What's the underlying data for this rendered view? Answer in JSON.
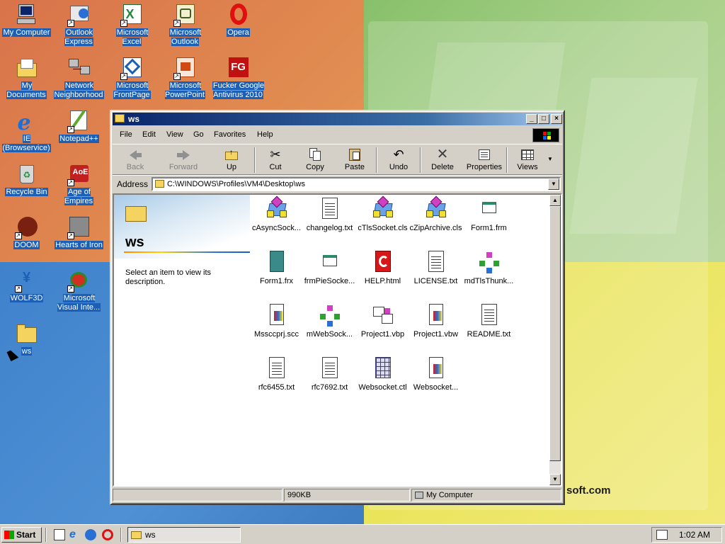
{
  "desktop": {
    "brand_text": "soft.com",
    "icons": [
      {
        "label": "My Computer",
        "icon": "my-computer-icon"
      },
      {
        "label": "Outlook Express",
        "icon": "outlook-express-icon"
      },
      {
        "label": "Microsoft Excel",
        "icon": "excel-icon"
      },
      {
        "label": "Microsoft Outlook",
        "icon": "outlook-icon"
      },
      {
        "label": "Opera",
        "icon": "opera-icon"
      },
      {
        "label": "My Documents",
        "icon": "my-documents-icon"
      },
      {
        "label": "Network Neighborhood",
        "icon": "network-icon"
      },
      {
        "label": "Microsoft FrontPage",
        "icon": "frontpage-icon"
      },
      {
        "label": "Microsoft PowerPoint",
        "icon": "powerpoint-icon"
      },
      {
        "label": "Fucker Google Antivirus 2010",
        "icon": "antivirus-icon"
      },
      {
        "label": "IE (Browservice)",
        "icon": "ie-icon"
      },
      {
        "label": "Notepad++",
        "icon": "notepad-icon"
      },
      {
        "label": "Recycle Bin",
        "icon": "recycle-bin-icon"
      },
      {
        "label": "Age of Empires",
        "icon": "age-of-empires-icon"
      },
      {
        "label": "DOOM",
        "icon": "doom-icon"
      },
      {
        "label": "Hearts of Iron",
        "icon": "hearts-of-iron-icon"
      },
      {
        "label": "WOLF3D",
        "icon": "wolf3d-icon"
      },
      {
        "label": "Microsoft Visual Inte...",
        "icon": "visual-interdev-icon"
      },
      {
        "label": "ws",
        "icon": "folder-icon"
      }
    ]
  },
  "window": {
    "title": "ws",
    "menu": [
      "File",
      "Edit",
      "View",
      "Go",
      "Favorites",
      "Help"
    ],
    "toolbar": [
      "Back",
      "Forward",
      "Up",
      "Cut",
      "Copy",
      "Paste",
      "Undo",
      "Delete",
      "Properties",
      "Views"
    ],
    "address_label": "Address",
    "address_value": "C:\\WINDOWS\\Profiles\\VM4\\Desktop\\ws",
    "webview": {
      "title": "ws",
      "description": "Select an item to view its description."
    },
    "files": [
      {
        "name": "cAsyncSock...",
        "icon": "class-file-icon"
      },
      {
        "name": "changelog.txt",
        "icon": "text-file-icon"
      },
      {
        "name": "cTlsSocket.cls",
        "icon": "class-file-icon"
      },
      {
        "name": "cZipArchive.cls",
        "icon": "class-file-icon"
      },
      {
        "name": "Form1.frm",
        "icon": "form-file-icon"
      },
      {
        "name": "Form1.frx",
        "icon": "binary-file-icon"
      },
      {
        "name": "frmPieSocke...",
        "icon": "form-file-icon"
      },
      {
        "name": "HELP.html",
        "icon": "html-file-icon"
      },
      {
        "name": "LICENSE.txt",
        "icon": "text-file-icon"
      },
      {
        "name": "mdTlsThunk...",
        "icon": "module-file-icon"
      },
      {
        "name": "Mssccprj.scc",
        "icon": "generic-file-icon"
      },
      {
        "name": "mWebSock...",
        "icon": "module-file-icon"
      },
      {
        "name": "Project1.vbp",
        "icon": "vb-project-icon"
      },
      {
        "name": "Project1.vbw",
        "icon": "generic-file-icon"
      },
      {
        "name": "README.txt",
        "icon": "text-file-icon"
      },
      {
        "name": "rfc6455.txt",
        "icon": "text-file-icon"
      },
      {
        "name": "rfc7692.txt",
        "icon": "text-file-icon"
      },
      {
        "name": "Websocket.ctl",
        "icon": "control-file-icon"
      },
      {
        "name": "Websocket...",
        "icon": "generic-file-icon"
      }
    ],
    "status": {
      "size": "990KB",
      "zone": "My Computer"
    }
  },
  "taskbar": {
    "start_label": "Start",
    "task_label": "ws",
    "clock": "1:02 AM"
  }
}
